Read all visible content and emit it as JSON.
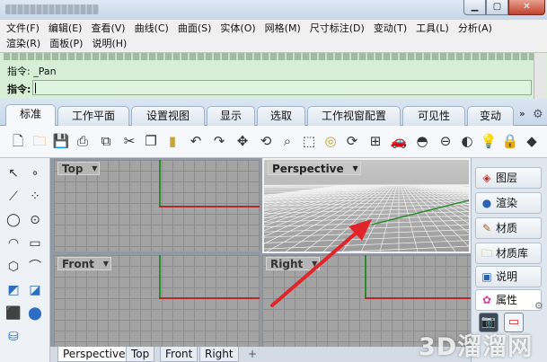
{
  "window": {
    "controls": {
      "minimize": "▁",
      "maximize": "▢",
      "close": "✕"
    }
  },
  "menu": {
    "row1": [
      "文件(F)",
      "编辑(E)",
      "查看(V)",
      "曲线(C)",
      "曲面(S)",
      "实体(O)",
      "网格(M)",
      "尺寸标注(D)",
      "变动(T)",
      "工具(L)",
      "分析(A)"
    ],
    "row2": [
      "渲染(R)",
      "面板(P)",
      "说明(H)"
    ]
  },
  "command": {
    "history_line": "指令: _Pan",
    "prompt_label": "指令:",
    "input_value": ""
  },
  "tabs": {
    "items": [
      "标准",
      "工作平面",
      "设置视图",
      "显示",
      "选取",
      "工作视窗配置",
      "可见性",
      "变动"
    ],
    "active": "标准",
    "more": "»"
  },
  "toolbar_icons": [
    "new-file-icon",
    "open-folder-icon",
    "save-icon",
    "print-icon",
    "export-icon",
    "cut-icon",
    "copy-icon",
    "paste-icon",
    "undo-icon",
    "redo-icon",
    "pan-icon",
    "rotate-view-icon",
    "zoom-icon",
    "zoom-window-icon",
    "zoom-extents-icon",
    "zoom-selected-icon",
    "rotate-icon",
    "four-viewports-icon",
    "car-icon",
    "render-icon",
    "orbit-icon",
    "properties-icon",
    "light-icon",
    "lock-icon",
    "layer-icon"
  ],
  "viewports": {
    "top": "Top",
    "perspective": "Perspective",
    "front": "Front",
    "right": "Right"
  },
  "viewport_tabs": {
    "items": [
      "Perspective",
      "Top",
      "Front",
      "Right"
    ],
    "active": "Perspective",
    "add": "+"
  },
  "right_panel": {
    "items": [
      {
        "label": "图层",
        "icon": "layers-icon"
      },
      {
        "label": "渲染",
        "icon": "render-icon"
      },
      {
        "label": "材质",
        "icon": "material-icon"
      },
      {
        "label": "材质库",
        "icon": "material-library-icon"
      },
      {
        "label": "说明",
        "icon": "help-icon"
      },
      {
        "label": "属性",
        "icon": "properties-icon"
      }
    ],
    "active": "属性"
  },
  "watermark": "3D溜溜网",
  "colors": {
    "command_bg": "#d6efd6",
    "viewport_bg": "#a3a3a3",
    "x_axis": "#b22a2a",
    "y_axis": "#2e8a2e",
    "arrow": "#e0262b"
  }
}
